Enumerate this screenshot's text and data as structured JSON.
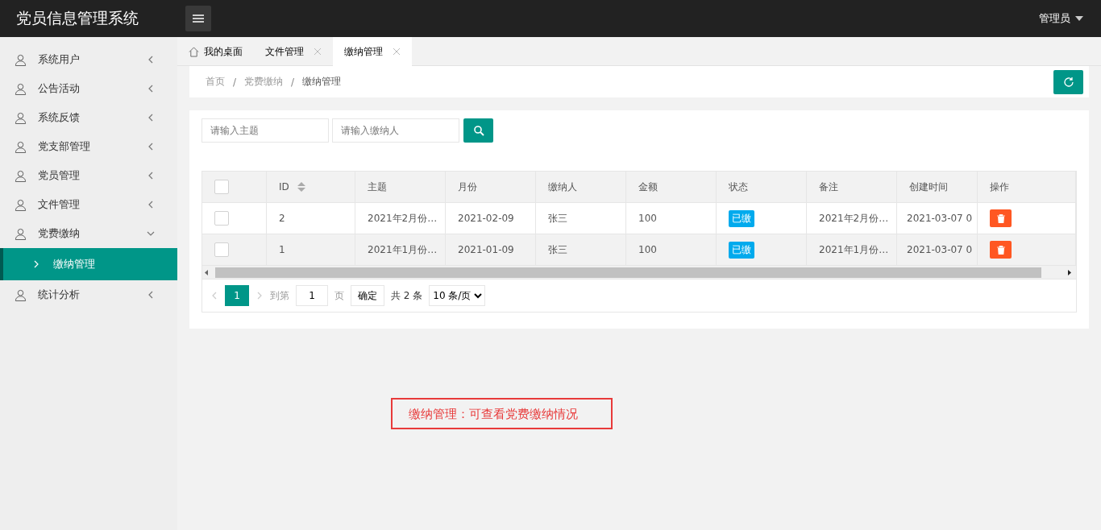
{
  "header": {
    "title": "党员信息管理系统",
    "user": "管理员"
  },
  "sidebar": {
    "items": [
      {
        "label": "系统用户",
        "expanded": false
      },
      {
        "label": "公告活动",
        "expanded": false
      },
      {
        "label": "系统反馈",
        "expanded": false
      },
      {
        "label": "党支部管理",
        "expanded": false
      },
      {
        "label": "党员管理",
        "expanded": false
      },
      {
        "label": "文件管理",
        "expanded": false
      },
      {
        "label": "党费缴纳",
        "expanded": true,
        "children": [
          {
            "label": "缴纳管理",
            "selected": true
          }
        ]
      },
      {
        "label": "统计分析",
        "expanded": false
      }
    ]
  },
  "tabs": [
    {
      "label": "我的桌面",
      "kind": "home",
      "selected": false
    },
    {
      "label": "文件管理",
      "kind": "closable",
      "selected": false
    },
    {
      "label": "缴纳管理",
      "kind": "closable",
      "selected": true
    }
  ],
  "breadcrumb": {
    "separator": "/",
    "items": [
      "首页",
      "党费缴纳",
      "缴纳管理"
    ]
  },
  "search": {
    "fields": [
      {
        "placeholder": "请输入主题"
      },
      {
        "placeholder": "请输入缴纳人"
      }
    ]
  },
  "table": {
    "columns": [
      {
        "label": "ID",
        "sortable": true
      },
      {
        "label": "主题"
      },
      {
        "label": "月份"
      },
      {
        "label": "缴纳人"
      },
      {
        "label": "金额"
      },
      {
        "label": "状态"
      },
      {
        "label": "备注"
      },
      {
        "label": "创建时间"
      },
      {
        "label": "操作"
      }
    ],
    "all_checked": false,
    "rows": [
      {
        "checked": false,
        "id": "2",
        "subject": "2021年2月份…",
        "month": "2021-02-09",
        "payer": "张三",
        "amount": "100",
        "status": "已缴",
        "note": "2021年2月份…",
        "created": "2021-03-07 0"
      },
      {
        "checked": false,
        "id": "1",
        "subject": "2021年1月份…",
        "month": "2021-01-09",
        "payer": "张三",
        "amount": "100",
        "status": "已缴",
        "note": "2021年1月份…",
        "created": "2021-03-07 0"
      }
    ]
  },
  "pagination": {
    "pages": [
      {
        "label": "1",
        "selected": true
      }
    ],
    "goto_label": "到第",
    "goto_value": "1",
    "page_unit": "页",
    "confirm": "确定",
    "total": "共 2 条",
    "page_size": "10 条/页"
  },
  "annotation": "缴纳管理：可查看党费缴纳情况"
}
